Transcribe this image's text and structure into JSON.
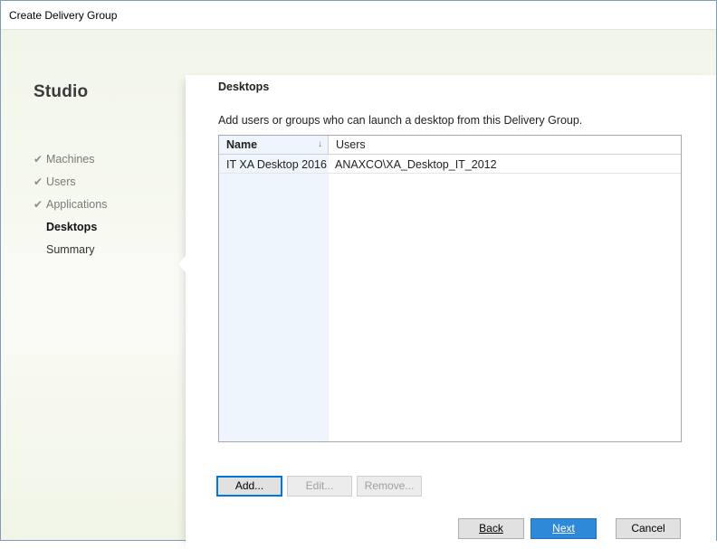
{
  "window": {
    "title": "Create Delivery Group"
  },
  "sidebar": {
    "app_name": "Studio",
    "steps": [
      {
        "label": "Machines",
        "done": true
      },
      {
        "label": "Users",
        "done": true
      },
      {
        "label": "Applications",
        "done": true
      },
      {
        "label": "Desktops",
        "done": false,
        "current": true
      },
      {
        "label": "Summary",
        "done": false
      }
    ],
    "check_glyph": "✔"
  },
  "main": {
    "heading": "Desktops",
    "instruction": "Add users or groups who can launch a desktop from this Delivery Group.",
    "table": {
      "columns": [
        {
          "label": "Name",
          "sorted": true
        },
        {
          "label": "Users",
          "sorted": false
        }
      ],
      "sort_glyph": "↓",
      "rows": [
        {
          "name": "IT XA Desktop 2016",
          "users": "ANAXCO\\XA_Desktop_IT_2012"
        }
      ]
    },
    "actions": {
      "add_label": "Add...",
      "edit_label": "Edit...",
      "remove_label": "Remove..."
    }
  },
  "footer": {
    "back_label": "Back",
    "next_label": "Next",
    "cancel_label": "Cancel"
  },
  "colors": {
    "accent": "#0078d7",
    "primary_button": "#2e8ad8",
    "name_column_bg": "#eef5fc"
  },
  "icons": {
    "check": "check-icon",
    "sort": "sort-descending-icon"
  }
}
